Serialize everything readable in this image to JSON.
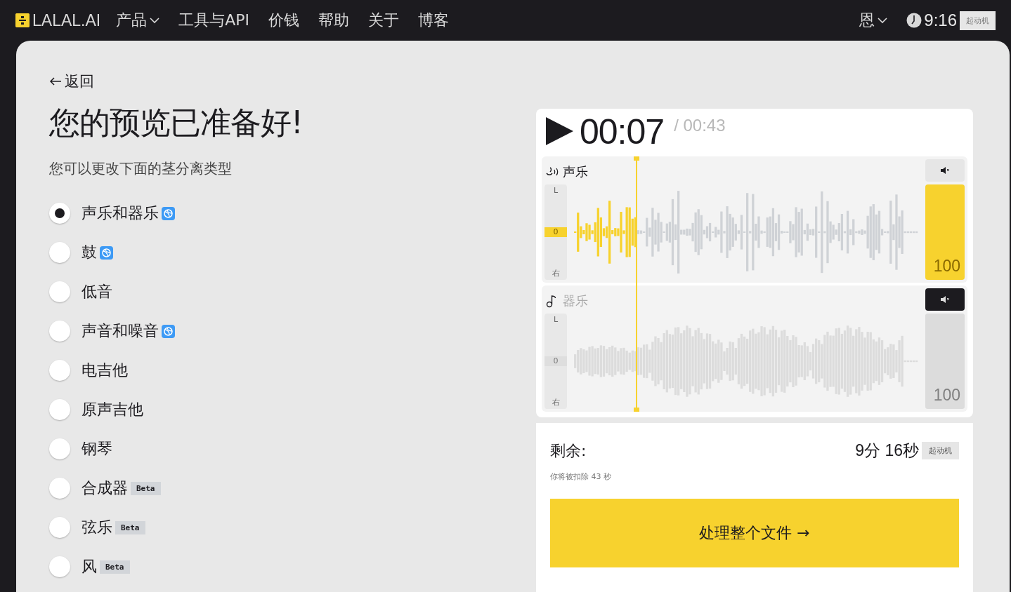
{
  "nav": {
    "logo": "LALAL.AI",
    "items": [
      {
        "label": "产品",
        "dropdown": true
      },
      {
        "label": "工具与API",
        "dropdown": false
      },
      {
        "label": "价钱",
        "dropdown": false
      },
      {
        "label": "帮助",
        "dropdown": false
      },
      {
        "label": "关于",
        "dropdown": false
      },
      {
        "label": "博客",
        "dropdown": false
      }
    ],
    "user": "恩",
    "time": "9:16",
    "plan_badge": "起动机"
  },
  "back": "返回",
  "title": "您的预览已准备好!",
  "subtitle": "您可以更改下面的茎分离类型",
  "stems": [
    {
      "label": "声乐和器乐",
      "selected": true,
      "kind": "app"
    },
    {
      "label": "鼓",
      "selected": false,
      "kind": "app"
    },
    {
      "label": "低音",
      "selected": false,
      "kind": "plain"
    },
    {
      "label": "声音和噪音",
      "selected": false,
      "kind": "app"
    },
    {
      "label": "电吉他",
      "selected": false,
      "kind": "plain"
    },
    {
      "label": "原声吉他",
      "selected": false,
      "kind": "plain"
    },
    {
      "label": "钢琴",
      "selected": false,
      "kind": "plain"
    },
    {
      "label": "合成器",
      "selected": false,
      "kind": "beta",
      "badge_text": "Beta"
    },
    {
      "label": "弦乐",
      "selected": false,
      "kind": "beta",
      "badge_text": "Beta"
    },
    {
      "label": "风",
      "selected": false,
      "kind": "beta",
      "badge_text": "Beta"
    }
  ],
  "player": {
    "time": "00:07",
    "total": "/ 00:43",
    "level": 0.18,
    "tracks": [
      {
        "name": "声乐",
        "kind": "vocal",
        "muted": false,
        "pan": {
          "top": "L",
          "mid": "0",
          "bottom": "右",
          "level": 0.5
        },
        "volume": "100",
        "level": 1
      },
      {
        "name": "器乐",
        "kind": "instrumental",
        "muted": true,
        "pan": {
          "top": "L",
          "mid": "0",
          "bottom": "右",
          "level": 0.5
        },
        "volume": "100",
        "level": 1
      }
    ]
  },
  "remaining": {
    "label": "剩余:",
    "value": "9分 16秒",
    "badge": "起动机",
    "note": "你将被扣除 43 秒",
    "button": "处理整个文件 →"
  }
}
